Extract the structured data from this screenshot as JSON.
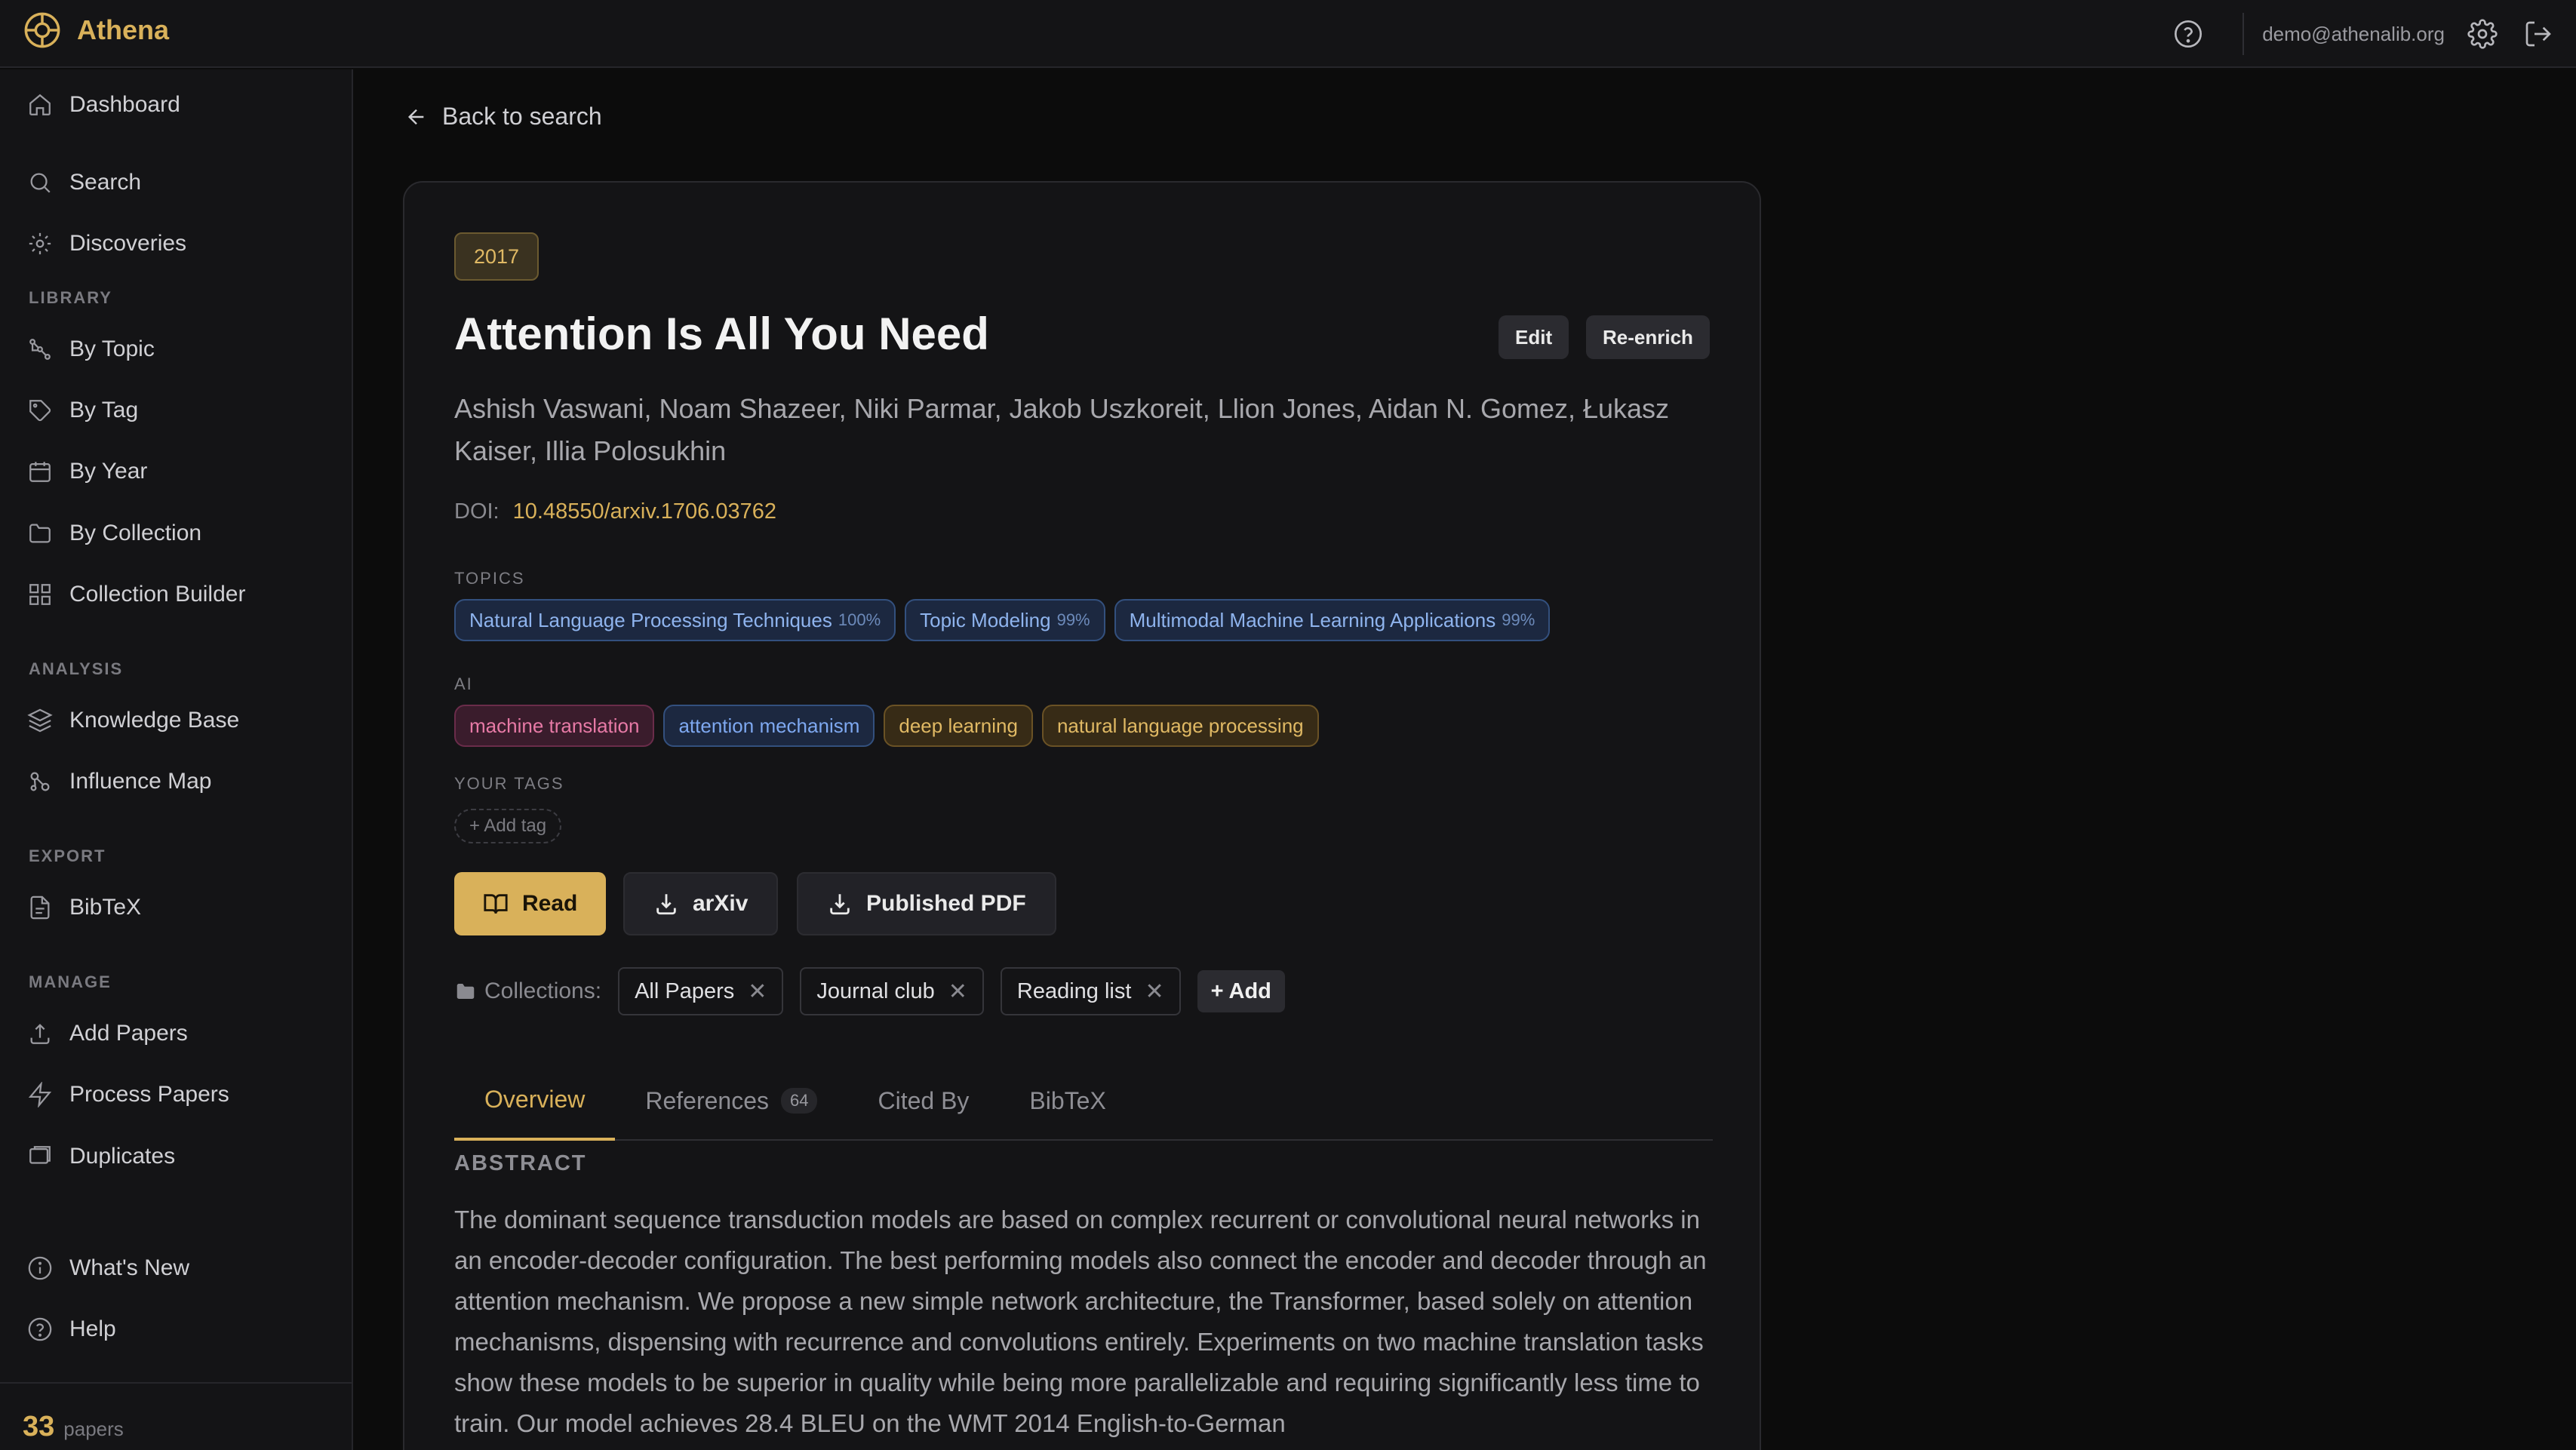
{
  "app": {
    "name": "Athena"
  },
  "topbar": {
    "user_email": "demo@athenalib.org"
  },
  "sidebar": {
    "main": [
      {
        "label": "Dashboard"
      },
      {
        "label": "Search"
      },
      {
        "label": "Discoveries"
      }
    ],
    "sections": [
      {
        "label": "LIBRARY",
        "items": [
          {
            "label": "By Topic"
          },
          {
            "label": "By Tag"
          },
          {
            "label": "By Year"
          },
          {
            "label": "By Collection"
          },
          {
            "label": "Collection Builder"
          }
        ]
      },
      {
        "label": "ANALYSIS",
        "items": [
          {
            "label": "Knowledge Base"
          },
          {
            "label": "Influence Map"
          }
        ]
      },
      {
        "label": "EXPORT",
        "items": [
          {
            "label": "BibTeX"
          }
        ]
      },
      {
        "label": "MANAGE",
        "items": [
          {
            "label": "Add Papers"
          },
          {
            "label": "Process Papers"
          },
          {
            "label": "Duplicates"
          }
        ]
      }
    ],
    "bottom": [
      {
        "label": "What's New"
      },
      {
        "label": "Help"
      }
    ],
    "paper_count": {
      "value": "33",
      "label": "papers"
    }
  },
  "main": {
    "back_label": "Back to search",
    "paper": {
      "year": "2017",
      "title": "Attention Is All You Need",
      "edit_label": "Edit",
      "reenrich_label": "Re-enrich",
      "authors": "Ashish Vaswani, Noam Shazeer, Niki Parmar, Jakob Uszkoreit, Llion Jones, Aidan N. Gomez, Łukasz Kaiser, Illia Polosukhin",
      "doi_label": "DOI:",
      "doi": "10.48550/arxiv.1706.03762",
      "topics_label": "TOPICS",
      "topics": [
        {
          "name": "Natural Language Processing Techniques",
          "pct": "100%"
        },
        {
          "name": "Topic Modeling",
          "pct": "99%"
        },
        {
          "name": "Multimodal Machine Learning Applications",
          "pct": "99%"
        }
      ],
      "ai_label": "AI",
      "ai_tags": [
        {
          "name": "machine translation",
          "color": "#e77aa6"
        },
        {
          "name": "attention mechanism",
          "color": "#7ea8f0"
        },
        {
          "name": "deep learning",
          "color": "#e0b964"
        },
        {
          "name": "natural language processing",
          "color": "#e0b964"
        }
      ],
      "your_tags_label": "YOUR TAGS",
      "add_tag_label": "+ Add tag",
      "actions": {
        "read": "Read",
        "arxiv": "arXiv",
        "published_pdf": "Published PDF"
      },
      "collections_label": "Collections:",
      "collections": [
        {
          "name": "All Papers"
        },
        {
          "name": "Journal club"
        },
        {
          "name": "Reading list"
        }
      ],
      "collections_add": "+ Add",
      "tabs": [
        {
          "label": "Overview"
        },
        {
          "label": "References",
          "count": "64"
        },
        {
          "label": "Cited By"
        },
        {
          "label": "BibTeX"
        }
      ],
      "abstract_label": "ABSTRACT",
      "abstract": "The dominant sequence transduction models are based on complex recurrent or convolutional neural networks in an encoder-decoder configuration. The best performing models also connect the encoder and decoder through an attention mechanism. We propose a new simple network architecture, the Transformer, based solely on attention mechanisms, dispensing with recurrence and convolutions entirely. Experiments on two machine translation tasks show these models to be superior in quality while being more parallelizable and requiring significantly less time to train. Our model achieves 28.4 BLEU on the WMT 2014 English-to-German"
    }
  },
  "colors": {
    "accent": "#d9b15a",
    "background": "#0c0c0c",
    "panel": "#141416"
  }
}
